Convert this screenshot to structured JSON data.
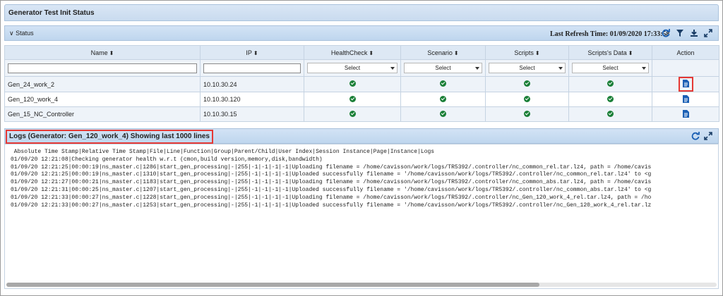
{
  "title": "Generator Test Init Status",
  "status": {
    "label": "Status",
    "last_refresh": "Last Refresh Time: 01/09/2020 17:33:58"
  },
  "table": {
    "headers": [
      "Name",
      "IP",
      "HealthCheck",
      "Scenario",
      "Scripts",
      "Scripts's Data",
      "Action"
    ],
    "select_placeholder": "Select",
    "rows": [
      {
        "name": "Gen_24_work_2",
        "ip": "10.10.30.24"
      },
      {
        "name": "Gen_120_work_4",
        "ip": "10.10.30.120"
      },
      {
        "name": "Gen_15_NC_Controller",
        "ip": "10.10.30.15"
      }
    ]
  },
  "logs": {
    "title": "Logs (Generator: Gen_120_work_4) Showing last 1000 lines",
    "lines": [
      " Absolute Time Stamp|Relative Time Stamp|File|Line|Function|Group|Parent/Child|User Index|Session Instance|Page|Instance|Logs",
      "01/09/20 12:21:08|Checking generator health w.r.t (cmon,build version,memory,disk,bandwidth)",
      "01/09/20 12:21:25|00:00:19|ns_master.c|1286|start_gen_processing|-|255|-1|-1|-1|-1|Uploading filename = /home/cavisson/work/logs/TR5392/.controller/nc_common_rel.tar.lz4, path = /home/cavis",
      "01/09/20 12:21:25|00:00:19|ns_master.c|1310|start_gen_processing|-|255|-1|-1|-1|-1|Uploaded successfully filename = '/home/cavisson/work/logs/TR5392/.controller/nc_common_rel.tar.lz4' to <g",
      "01/09/20 12:21:27|00:00:21|ns_master.c|1183|start_gen_processing|-|255|-1|-1|-1|-1|Uploading filename = /home/cavisson/work/logs/TR5392/.controller/nc_common_abs.tar.lz4, path = /home/cavis",
      "01/09/20 12:21:31|00:00:25|ns_master.c|1207|start_gen_processing|-|255|-1|-1|-1|-1|Uploaded successfully filename = '/home/cavisson/work/logs/TR5392/.controller/nc_common_abs.tar.lz4' to <g",
      "01/09/20 12:21:33|00:00:27|ns_master.c|1228|start_gen_processing|-|255|-1|-1|-1|-1|Uploading filename = /home/cavisson/work/logs/TR5392/.controller/nc_Gen_120_work_4_rel.tar.lz4, path = /ho",
      "01/09/20 12:21:33|00:00:27|ns_master.c|1253|start_gen_processing|-|255|-1|-1|-1|-1|Uploaded successfully filename = '/home/cavisson/work/logs/TR5392/.controller/nc_Gen_120_work_4_rel.tar.lz"
    ]
  },
  "colors": {
    "accent": "#1a5fb4",
    "highlight": "#e53935",
    "ok": "#1a7f37"
  }
}
